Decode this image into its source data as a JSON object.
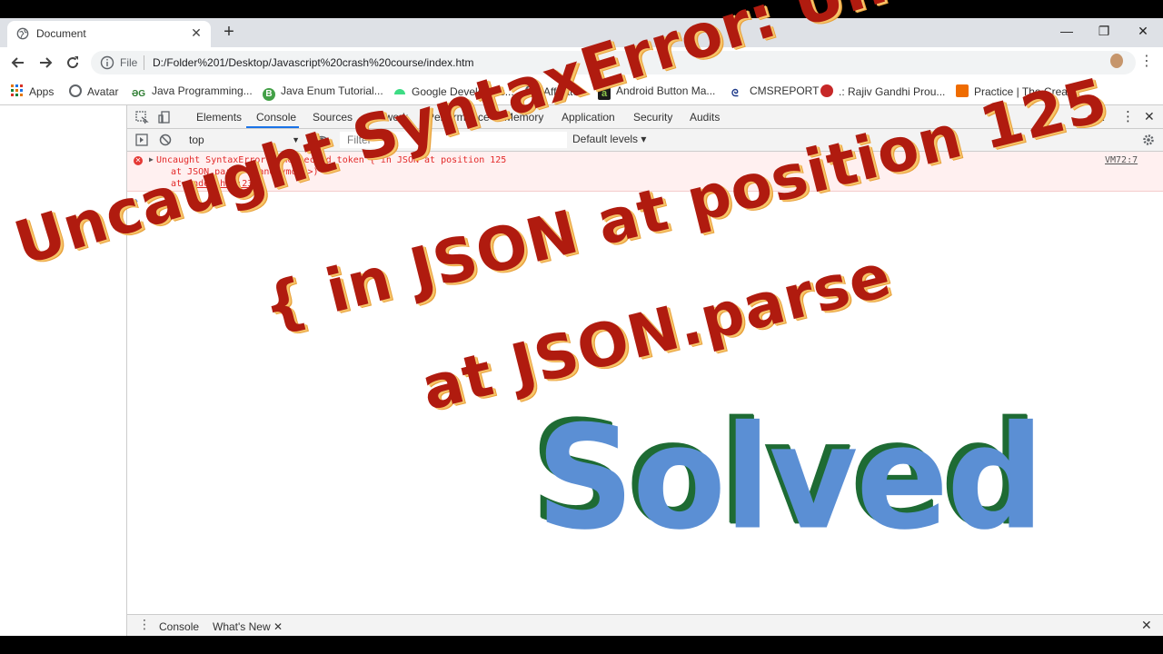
{
  "browser": {
    "tab_title": "Document",
    "tab_close": "✕",
    "new_tab": "+",
    "window_buttons": [
      "—",
      "❐",
      "✕"
    ],
    "scheme": "File",
    "url": "D:/Folder%201/Desktop/Javascript%20crash%20course/index.htm"
  },
  "bookmarks": [
    {
      "label": "Apps",
      "color": "#e37400"
    },
    {
      "label": "Avatar",
      "color": "#5f6368"
    },
    {
      "label": "Java Programming...",
      "color": "#2e7d32"
    },
    {
      "label": "Java Enum Tutorial...",
      "color": "#43a047"
    },
    {
      "label": "Google Developers...",
      "color": "#3ddc84"
    },
    {
      "label": "Affiliates",
      "color": "#5f6368"
    },
    {
      "label": "Android Button Ma...",
      "color": "#8bc34a"
    },
    {
      "label": "CMSREPORT",
      "color": "#1e3a8a"
    },
    {
      "label": ".: Rajiv Gandhi Prou...",
      "color": "#c62828"
    },
    {
      "label": "Practice | The Crea...",
      "color": "#ef6c00"
    }
  ],
  "devtools": {
    "tabs": [
      "Elements",
      "Console",
      "Sources",
      "Network",
      "Performance",
      "Memory",
      "Application",
      "Security",
      "Audits"
    ],
    "active_tab": "Console",
    "error_count": "1",
    "context": "top",
    "filter_placeholder": "Filter",
    "levels": "Default levels ▾",
    "error": {
      "line1": "Uncaught SyntaxError: Unexpected token { in JSON at position 125",
      "line2": "at JSON.parse (<anonymous>)",
      "line3_prefix": "at ",
      "line3_link": "index.htm:23",
      "source": "VM72:7"
    },
    "prompt": "›",
    "drawer_tabs": [
      "Console",
      "What's New"
    ],
    "drawer_close": "✕"
  },
  "overlay": {
    "line1": "Uncaught SyntaxError: Unexpected token",
    "line2": "{ in JSON at position 125",
    "line3": "at JSON.parse",
    "solved": "Solved"
  }
}
